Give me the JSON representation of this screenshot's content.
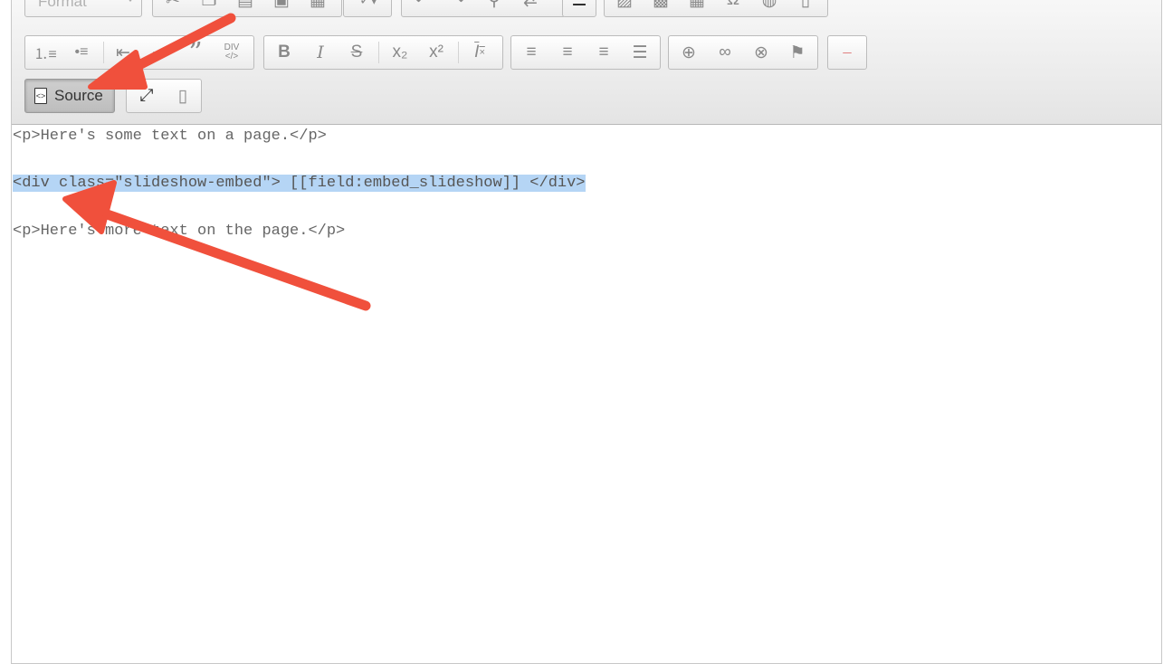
{
  "toolbar": {
    "format_label": "Format",
    "source_label": "Source",
    "blockquote_glyph": "”",
    "div_label": "DIV",
    "special_char_glyph": "Ω",
    "bold_glyph": "B",
    "italic_glyph": "I",
    "strike_glyph": "S",
    "remove_format_glyph": "I"
  },
  "editor": {
    "lines": [
      "<p>Here's some text on a page.</p>",
      "<div class=\"slideshow-embed\"> [[field:embed_slideshow]] </div>",
      "<p>Here's more text on the page.</p>"
    ]
  },
  "colors": {
    "selection": "#b5d5f5",
    "arrow": "#f0503c"
  }
}
